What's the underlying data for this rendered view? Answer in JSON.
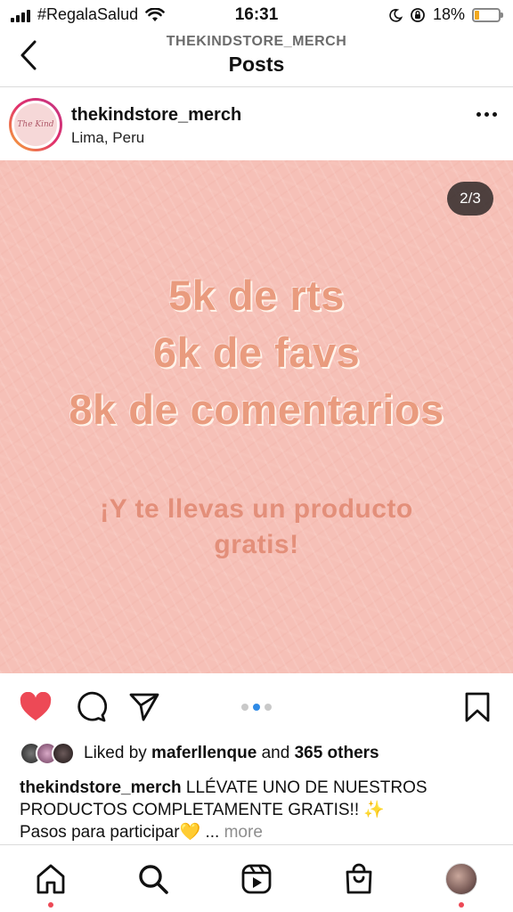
{
  "status_bar": {
    "carrier": "#RegalaSalud",
    "time": "16:31",
    "battery": "18%",
    "battery_level": 0.18,
    "battery_color": "#f2a91f"
  },
  "header": {
    "subtitle": "THEKINDSTORE_MERCH",
    "title": "Posts"
  },
  "post": {
    "username": "thekindstore_merch",
    "location": "Lima, Peru",
    "avatar_logo_text": "The Kind",
    "counter": "2/3",
    "image_lines": [
      "5k de rts",
      "6k de favs",
      "8k de comentarios"
    ],
    "promo_line_1": "¡Y te llevas un producto",
    "promo_line_2": "gratis!",
    "image_bg_color": "#f6c0b7",
    "carousel": {
      "count": 3,
      "active": 2
    }
  },
  "actions": {
    "like_icon": "heart-filled-icon",
    "comment_icon": "comment-icon",
    "share_icon": "send-icon",
    "save_icon": "bookmark-icon",
    "like_color": "#ed4956"
  },
  "likes": {
    "prefix": "Liked by ",
    "user": "maferllenque",
    "connector": " and ",
    "others": "365 others"
  },
  "caption": {
    "username": "thekindstore_merch",
    "text_line_1": " LLÉVATE UNO DE NUESTROS",
    "text_line_2": "PRODUCTOS COMPLETAMENTE GRATIS!! ✨",
    "text_line_3": "Pasos para participar💛 ...",
    "more": "more"
  },
  "bottom_nav": {
    "items": [
      "home-icon",
      "search-icon",
      "reels-icon",
      "shop-icon",
      "profile-avatar"
    ]
  }
}
